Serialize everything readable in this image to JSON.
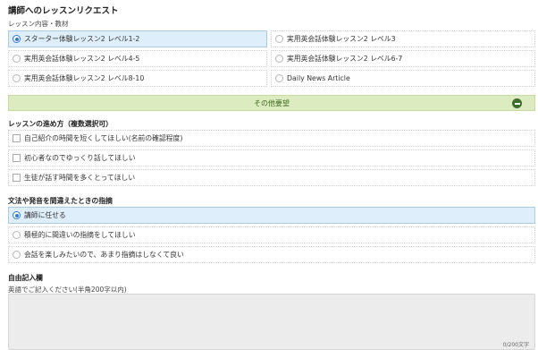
{
  "title": "講師へのレッスンリクエスト",
  "material_label": "レッスン内容・教材",
  "materials": [
    "スターター体験レッスン2 レベル1-2",
    "実用英会話体験レッスン2 レベル3",
    "実用英会話体験レッスン2 レベル4-5",
    "実用英会話体験レッスン2 レベル6-7",
    "実用英会話体験レッスン2 レベル8-10",
    "Daily News Article"
  ],
  "materials_selected": 0,
  "more_requests_label": "その他要望",
  "progress_section": {
    "heading": "レッスンの進め方（複数選択可）",
    "options": [
      "自己紹介の時間を短くしてほしい(名前の確認程度)",
      "初心者なのでゆっくり話してほしい",
      "生徒が話す時間を多くとってほしい"
    ]
  },
  "correction_section": {
    "heading": "文法や発音を間違えたときの指摘",
    "options": [
      "講師に任せる",
      "積極的に間違いの指摘をしてほしい",
      "会話を楽しみたいので、あまり指摘はしなくて良い"
    ],
    "selected": 0
  },
  "free_section": {
    "heading": "自由記入欄",
    "note": "英語でご記入ください(半角200字以内)",
    "value": "",
    "counter": "0/200文字"
  },
  "colors": {
    "selected_bg": "#deeefb",
    "selected_border": "#a8cbe9",
    "radio_accent": "#2d7bd6",
    "more_bar_bg": "#dcecc0",
    "more_bar_icon": "#3f6e2a"
  },
  "icons": {
    "more_toggle": "minus-circle-icon"
  }
}
